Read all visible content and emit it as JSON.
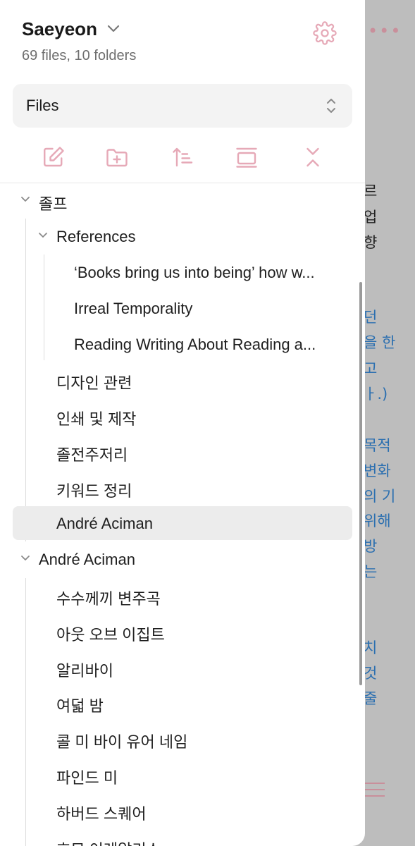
{
  "vault": {
    "name": "Saeyeon",
    "stats": "69 files, 10 folders"
  },
  "explorer_select": {
    "label": "Files"
  },
  "toolbar": {
    "icons": [
      "new-note-icon",
      "new-folder-icon",
      "sort-icon",
      "auto-reveal-icon",
      "collapse-all-icon"
    ]
  },
  "tree": {
    "folder_1": {
      "label": "졸프"
    },
    "subfolder_references": {
      "label": "References"
    },
    "ref_1": {
      "label": "‘Books bring us into being’ how w..."
    },
    "ref_2": {
      "label": "Irreal Temporality"
    },
    "ref_3": {
      "label": "Reading Writing About Reading a..."
    },
    "item_1": {
      "label": "디자인 관련"
    },
    "item_2": {
      "label": "인쇄 및 제작"
    },
    "item_3": {
      "label": "졸전주저리"
    },
    "item_4": {
      "label": "키워드 정리"
    },
    "item_5": {
      "label": "André Aciman"
    },
    "folder_2": {
      "label": "André Aciman"
    },
    "book_1": {
      "label": "수수께끼 변주곡"
    },
    "book_2": {
      "label": "아웃 오브 이집트"
    },
    "book_3": {
      "label": "알리바이"
    },
    "book_4": {
      "label": "여덟 밤"
    },
    "book_5": {
      "label": "콜 미 바이 유어 네임"
    },
    "book_6": {
      "label": "파인드 미"
    },
    "book_7": {
      "label": "하버드 스퀘어"
    },
    "book_8": {
      "label": "호모 이레알리스"
    }
  },
  "background_editor": {
    "more_label": "•••",
    "lines": [
      "르",
      "업",
      "향",
      "던",
      "을 한",
      "고",
      "ㅏ.)",
      "목적",
      "변화",
      "의 기",
      "위해",
      "방",
      "는",
      "치",
      "것",
      "줄"
    ]
  },
  "colors": {
    "accent": "#e6a9b7",
    "active_row": "#ececec"
  }
}
